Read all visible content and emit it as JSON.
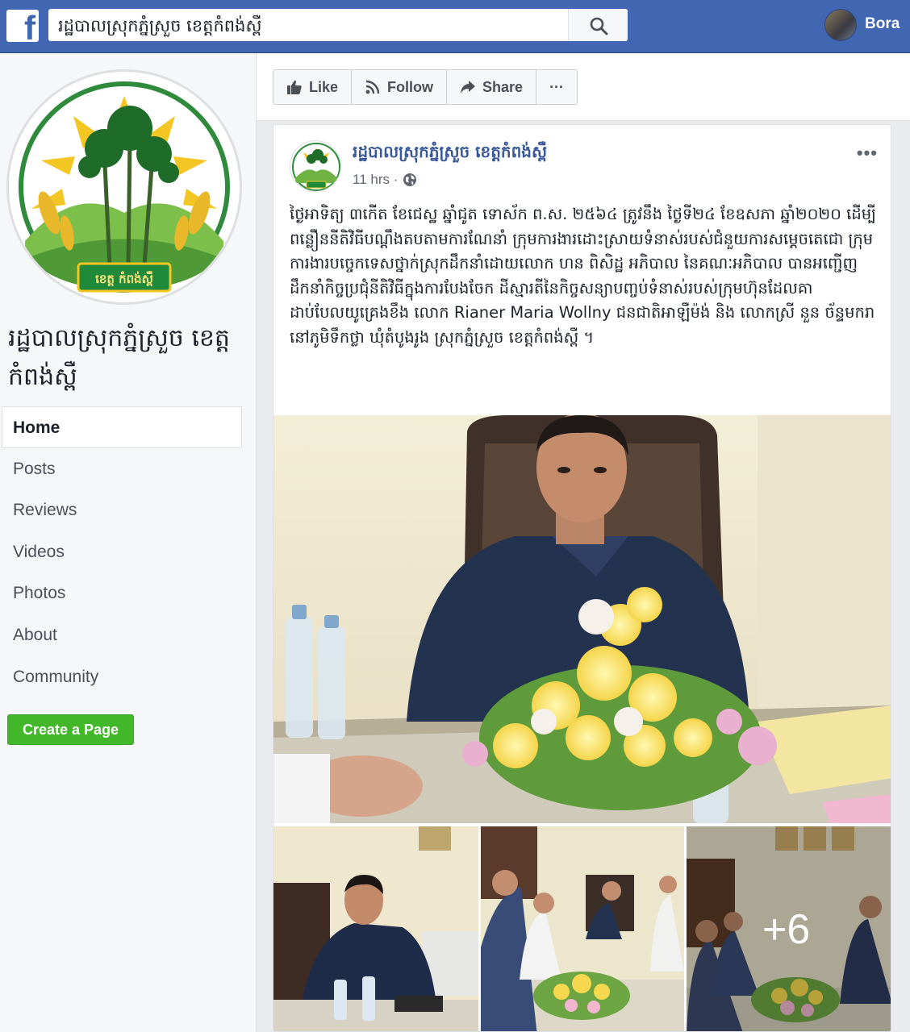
{
  "topbar": {
    "search_value": "រដ្ឋបាលស្រុកភ្នំស្រួច ខេត្តកំពង់ស្ពឺ",
    "profile_name": "Bora",
    "brand_color": "#4267b2"
  },
  "page": {
    "title": "រដ្ឋបាលស្រុកភ្នំស្រួច ខេត្តកំពង់ស្ពឺ",
    "logo_banner_text": "ខេត្ត កំពង់ស្ពឺ"
  },
  "nav": {
    "items": [
      {
        "label": "Home",
        "active": true
      },
      {
        "label": "Posts"
      },
      {
        "label": "Reviews"
      },
      {
        "label": "Videos"
      },
      {
        "label": "Photos"
      },
      {
        "label": "About"
      },
      {
        "label": "Community"
      }
    ],
    "create_page": "Create a Page"
  },
  "actions": {
    "like": "Like",
    "follow": "Follow",
    "share": "Share",
    "more": "···"
  },
  "post": {
    "author": "រដ្ឋបាលស្រុកភ្នំស្រួច ខេត្តកំពង់ស្ពឺ",
    "time": "11 hrs ·",
    "more": "•••",
    "text": "ថ្ងៃអាទិត្យ ៣កើត ខែជេស្ឋ ឆ្នាំជូត ទោស័ក ព.ស. ២៥៦៤ ត្រូវនឹង ថ្ងៃទី២៤ ខែឧសភា ឆ្នាំ២០២០ ដើម្បីពន្លឿននីតិវិធីបណ្តឹងតបតាមការណែនាំ ក្រុមការងារដោះស្រាយទំនាស់របស់ជំនួយការសម្តេចតេជោ ក្រុមការងារបច្ចេកទេសថ្នាក់ស្រុកដឹកនាំដោយលោក ហន ពិសិដ្ឋ អភិបាល នៃគណៈអភិបាល បានអញ្ជើញដឹកនាំកិច្ចប្រជុំនីតិវិធីក្នុងការបែងចែក ដីស្មារតីនៃកិច្ចសន្យាបញ្ចប់ទំនាស់របស់ក្រុមហ៊ុនដែលគាដាប់បែលយូគ្រេងខឹង លោក Rianer Maria Wollny ជនជាតិអាឡឺម៉ង់ និង លោកស្រី នួន ច័ន្ទមករា នៅភូមិទឹកថ្លា ឃុំតំបូងរូង ស្រុកភ្នំស្រួច ខេត្តកំពង់ស្ពឺ ។",
    "more_photos": "+6"
  }
}
